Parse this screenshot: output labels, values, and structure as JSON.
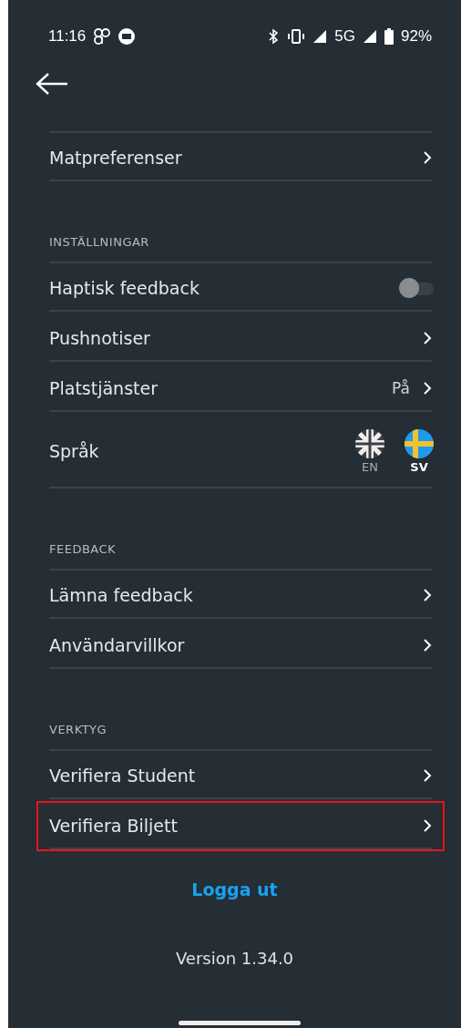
{
  "status_bar": {
    "time": "11:16",
    "network": "5G",
    "battery": "92%"
  },
  "sections": [
    {
      "items": [
        {
          "kind": "link",
          "label": "Matpreferenser",
          "highlighted": false
        }
      ]
    },
    {
      "header": "INSTÄLLNINGAR",
      "items": [
        {
          "kind": "toggle",
          "label": "Haptisk feedback",
          "on": false,
          "highlighted": false
        },
        {
          "kind": "link",
          "label": "Pushnotiser",
          "highlighted": false
        },
        {
          "kind": "link",
          "label": "Platstjänster",
          "value": "På",
          "highlighted": false
        },
        {
          "kind": "language",
          "label": "Språk",
          "highlighted": false,
          "options": [
            {
              "kind": "uk",
              "code": "EN",
              "selected": false
            },
            {
              "kind": "se",
              "code": "SV",
              "selected": true
            }
          ]
        }
      ]
    },
    {
      "header": "FEEDBACK",
      "items": [
        {
          "kind": "link",
          "label": "Lämna feedback",
          "highlighted": false
        },
        {
          "kind": "link",
          "label": "Användarvillkor",
          "highlighted": false
        }
      ]
    },
    {
      "header": "VERKTYG",
      "items": [
        {
          "kind": "link",
          "label": "Verifiera Student",
          "highlighted": false
        },
        {
          "kind": "link",
          "label": "Verifiera Biljett",
          "highlighted": true
        }
      ]
    }
  ],
  "logout": "Logga ut",
  "version": "Version 1.34.0"
}
